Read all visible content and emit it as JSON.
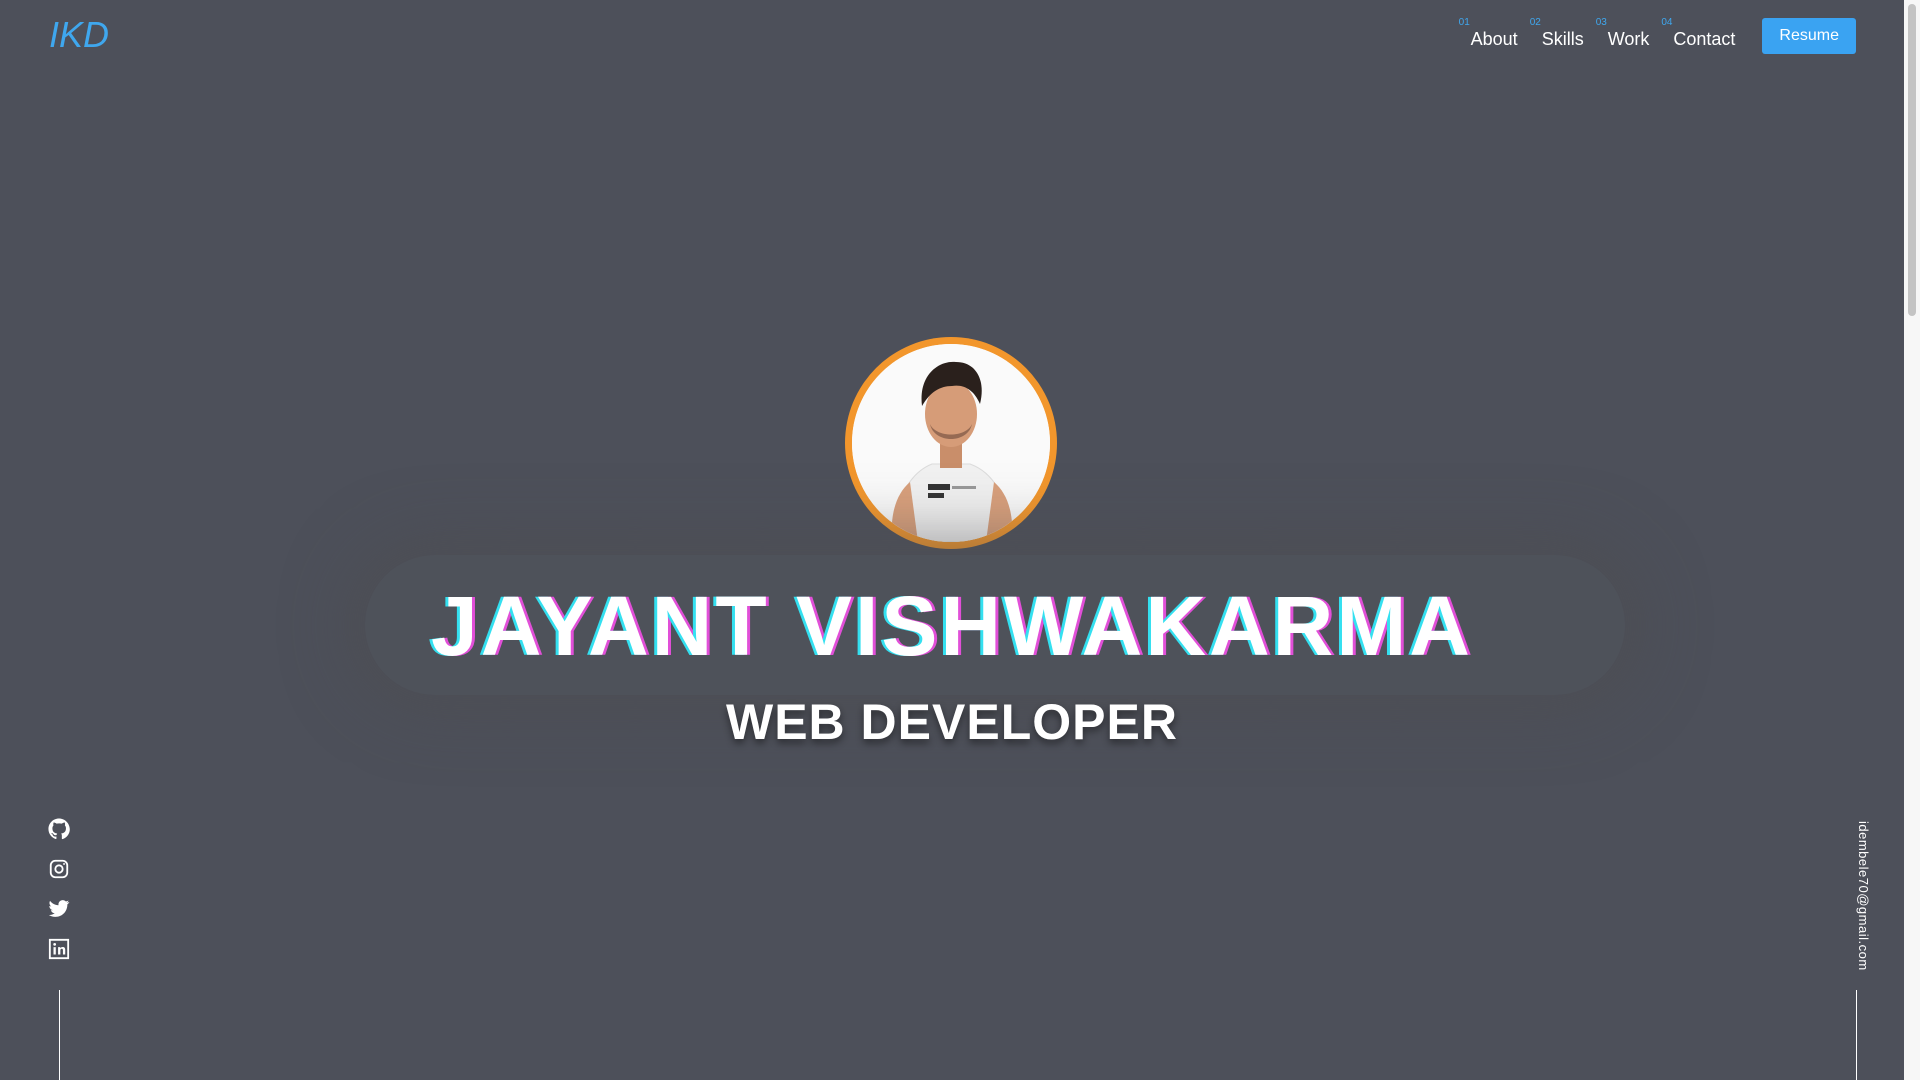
{
  "header": {
    "logo": "IKD",
    "nav": [
      {
        "num": "01",
        "label": "About"
      },
      {
        "num": "02",
        "label": "Skills"
      },
      {
        "num": "03",
        "label": "Work"
      },
      {
        "num": "04",
        "label": "Contact"
      }
    ],
    "resume_label": "Resume"
  },
  "hero": {
    "name": "JAYANT VISHWAKARMA",
    "role": "WEB DEVELOPER"
  },
  "social": {
    "icons": [
      "github-icon",
      "instagram-icon",
      "twitter-icon",
      "linkedin-icon"
    ]
  },
  "email": "idembele70@gmail.com",
  "colors": {
    "background": "#4d505a",
    "accent": "#3fa7ee",
    "avatar_ring": "#f2962c"
  }
}
